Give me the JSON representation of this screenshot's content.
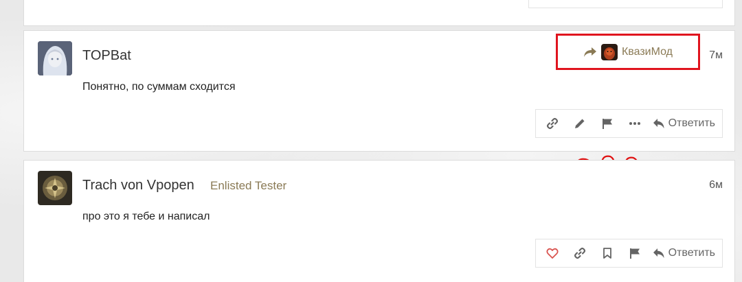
{
  "posts": [
    {
      "username": "TOPBat",
      "title": "",
      "time": "7м",
      "body": "Понятно, по суммам сходится",
      "reply_to": {
        "name": "КвазиМод"
      },
      "actions": [
        "link-icon",
        "pencil-icon",
        "flag-icon",
        "more-icon"
      ],
      "reply_label": "Ответить"
    },
    {
      "username": "Trach von Vpopen",
      "title": "Enlisted Tester",
      "time": "6м",
      "body": "про это я тебе и написал",
      "actions": [
        "heart-icon",
        "link-icon",
        "bookmark-icon",
        "flag-icon"
      ],
      "reply_label": "Ответить"
    }
  ],
  "annotation": "???",
  "colors": {
    "accent_text": "#8a7a55",
    "highlight_box": "#e0141e",
    "heart": "#d9534f",
    "icon": "#646464"
  }
}
